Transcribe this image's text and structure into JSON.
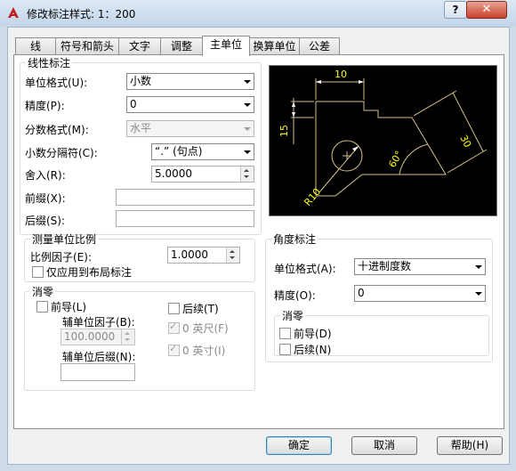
{
  "window": {
    "title": "修改标注样式: 1：200",
    "help_label": "?",
    "close_label": "✕"
  },
  "tabs": [
    {
      "label": "线",
      "active": false
    },
    {
      "label": "符号和箭头",
      "active": false
    },
    {
      "label": "文字",
      "active": false
    },
    {
      "label": "调整",
      "active": false
    },
    {
      "label": "主单位",
      "active": true
    },
    {
      "label": "换算单位",
      "active": false
    },
    {
      "label": "公差",
      "active": false
    }
  ],
  "linear": {
    "legend": "线性标注",
    "unit_format_label": "单位格式(U):",
    "unit_format_value": "小数",
    "precision_label": "精度(P):",
    "precision_value": "0",
    "fraction_label": "分数格式(M):",
    "fraction_value": "水平",
    "decimal_sep_label": "小数分隔符(C):",
    "decimal_sep_value": "“.” (句点)",
    "round_label": "舍入(R):",
    "round_value": "5.0000",
    "prefix_label": "前缀(X):",
    "prefix_value": "",
    "suffix_label": "后缀(S):",
    "suffix_value": ""
  },
  "scale": {
    "legend": "测量单位比例",
    "factor_label": "比例因子(E):",
    "factor_value": "1.0000",
    "layout_only_label": "仅应用到布局标注"
  },
  "zero_linear": {
    "legend": "消零",
    "leading_label": "前导(L)",
    "sub_factor_label": "辅单位因子(B):",
    "sub_factor_value": "100.0000",
    "sub_suffix_label": "辅单位后缀(N):",
    "sub_suffix_value": "",
    "trailing_label": "后续(T)",
    "feet_label": "0 英尺(F)",
    "inch_label": "0 英寸(I)"
  },
  "angular": {
    "legend": "角度标注",
    "unit_format_label": "单位格式(A):",
    "unit_format_value": "十进制度数",
    "precision_label": "精度(O):",
    "precision_value": "0"
  },
  "zero_angular": {
    "legend": "消零",
    "leading_label": "前导(D)",
    "trailing_label": "后续(N)"
  },
  "preview": {
    "dim_top": "10",
    "dim_left": "15",
    "dim_right": "30",
    "dim_radius": "R10",
    "dim_angle": "60°"
  },
  "colors": {
    "preview_bg": "#000000",
    "preview_lines": "#d2c08a",
    "dim_text": "#ffff00"
  },
  "footer": {
    "ok_label": "确定",
    "cancel_label": "取消",
    "help_label": "帮助(H)"
  }
}
